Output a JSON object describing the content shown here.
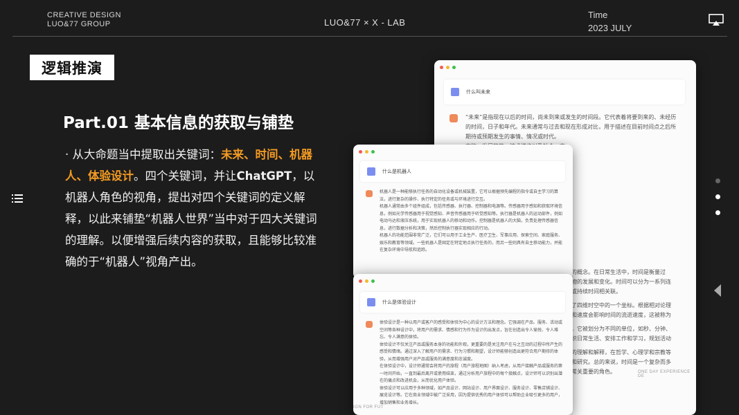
{
  "header": {
    "brand_line1": "CREATIVE DESIGN",
    "brand_line2": "LUO&77 GROUP",
    "center": "LUO&77 ×  X - LAB",
    "time_label": "Time",
    "time_value": "2023 JULY"
  },
  "section_tag": "逻辑推演",
  "part_title": "Part.01  基本信息的获取与铺垫",
  "body": {
    "prefix": "· 从大命题当中提取出关键词：",
    "keywords": "未来、时间、机器人、体验设计",
    "mid": "。四个关键词，并让",
    "chatgpt": "ChatGPT",
    "rest": "，以机器人角色的视角，提出对四个关键词的定义解释，以此来铺垫“机器人世界”当中对于四大关键词的理解。以便增强后续内容的获取，且能够比较准确的于“机器人”视角产出。"
  },
  "card1": {
    "question": "什么叫未来",
    "answer": "“未来”是指现在以后的时间，尚未到来或发生的时间段。它代表着将要到来的、未经历的时间，日子和年代。未来通常与过去和现在形成对比，用于描述在目前时间点之后所期待或预期发生的事情、情况或时代。|事物、发展趋势、技术进步以及社会、文|也承载着对新的可能性和未知领域的好奇||未来科技、未来社会、未来经济等，都|做出更明智的决策，规划和准备，以应对|去，未来也是个人发展、梦想实现和目标",
    "answer2": "的概念。在日常生活中，时间是衡量过|物的发展和变化。时间可以分为一系列连|或持续时间相关联。||了四维时空中的一个坐标。根据相对论理|和速度会影响时间的流逝速度，这被称为||，它被划分为不同的单位，如秒、分钟、|织日常生活、安排工作和学习，规划活动||的理解和解释，在哲学、心理学和宗教等|和研究。总的来说，时间是一个复杂而多|常关重要的角色。"
  },
  "card2": {
    "question": "什么是机器人",
    "answer": "机器人是一种能够执行任务的自动化设备或机械装置，它可以根据预先编程的指令或自主学习的算法，进行复杂的操作、执行特定的任务或与环境进行交互。|机器人通常由多个组件组成，包括传感器、执行器、控制器和电源等。传感器用于感知和获取环境信息，例如光学传感器用于视觉感知、声音传感器用于听觉感知等。执行器是机器人的运动部件，例如电动马达和液压系统，用于实现机器人的移动和动作。控制器是机器人的大脑，负责处理传感器信息，进行数据分析和决策，然后控制执行器实现相应的行动。|机器人的功能范围非常广泛，它们可以用于工业生产、医疗卫生、军事应用、探索空间、家庭服务、娱乐和教育等领域。一些机器人是固定在特定地点执行任务的，而另一些则具有自主移动能力，并能在复杂环境中导航和追踪。"
  },
  "card3": {
    "question": "什么是体验设计",
    "answer": "体验设计是一种以用户或客户的感受和体验为中心的设计方法和理念。它强调在产品、服务、活动或空间等各种设计中，将用户的需求、情感和行为作为设计的出发点，旨在创造出令人愉悦、令人难忘、令人满意的体验。|体验设计不仅关注产品或服务本身的功能和外观，更重要的是关注用户在与之互动的过程中所产生的感受和情绪。通过深入了解用户的需求、行为习惯和期望，设计师能够创造出更符合用户期待的体验，从而增强用户对产品或服务的满意度和忠诚度。|在体验设计中，设计师通常会将用户的旅程（用户旅程地图）纳入考虑，从用户接触产品或服务的第一时间开始，一直到最后离开或使用结束，通过分析用户旅程中的每个接触点，设计师可以识别出潜在的痛点和改进机会，从而优化用户体验。|体验设计可以应用于多种领域，如产品设计、网站设计、用户界面设计、服务设计、零售店铺设计、展览设计等。它在商业领域中被广泛采用，因为提供优秀的用户体验可以帮助企业吸引更多的用户，增加销售和业务增长。"
  },
  "watermarks": {
    "card1": "ONE DAY EXPERIENCE DE",
    "card3": "IGN FOR FUT"
  },
  "colors": {
    "accent": "#f39a22",
    "background": "#1c1c1c",
    "traffic_red": "#f25b50",
    "traffic_yellow": "#f5b82e",
    "traffic_green": "#3cc24b"
  },
  "icons": [
    "cast-icon",
    "menu-icon",
    "chevron-left-icon",
    "user-avatar-icon",
    "chatgpt-icon"
  ]
}
